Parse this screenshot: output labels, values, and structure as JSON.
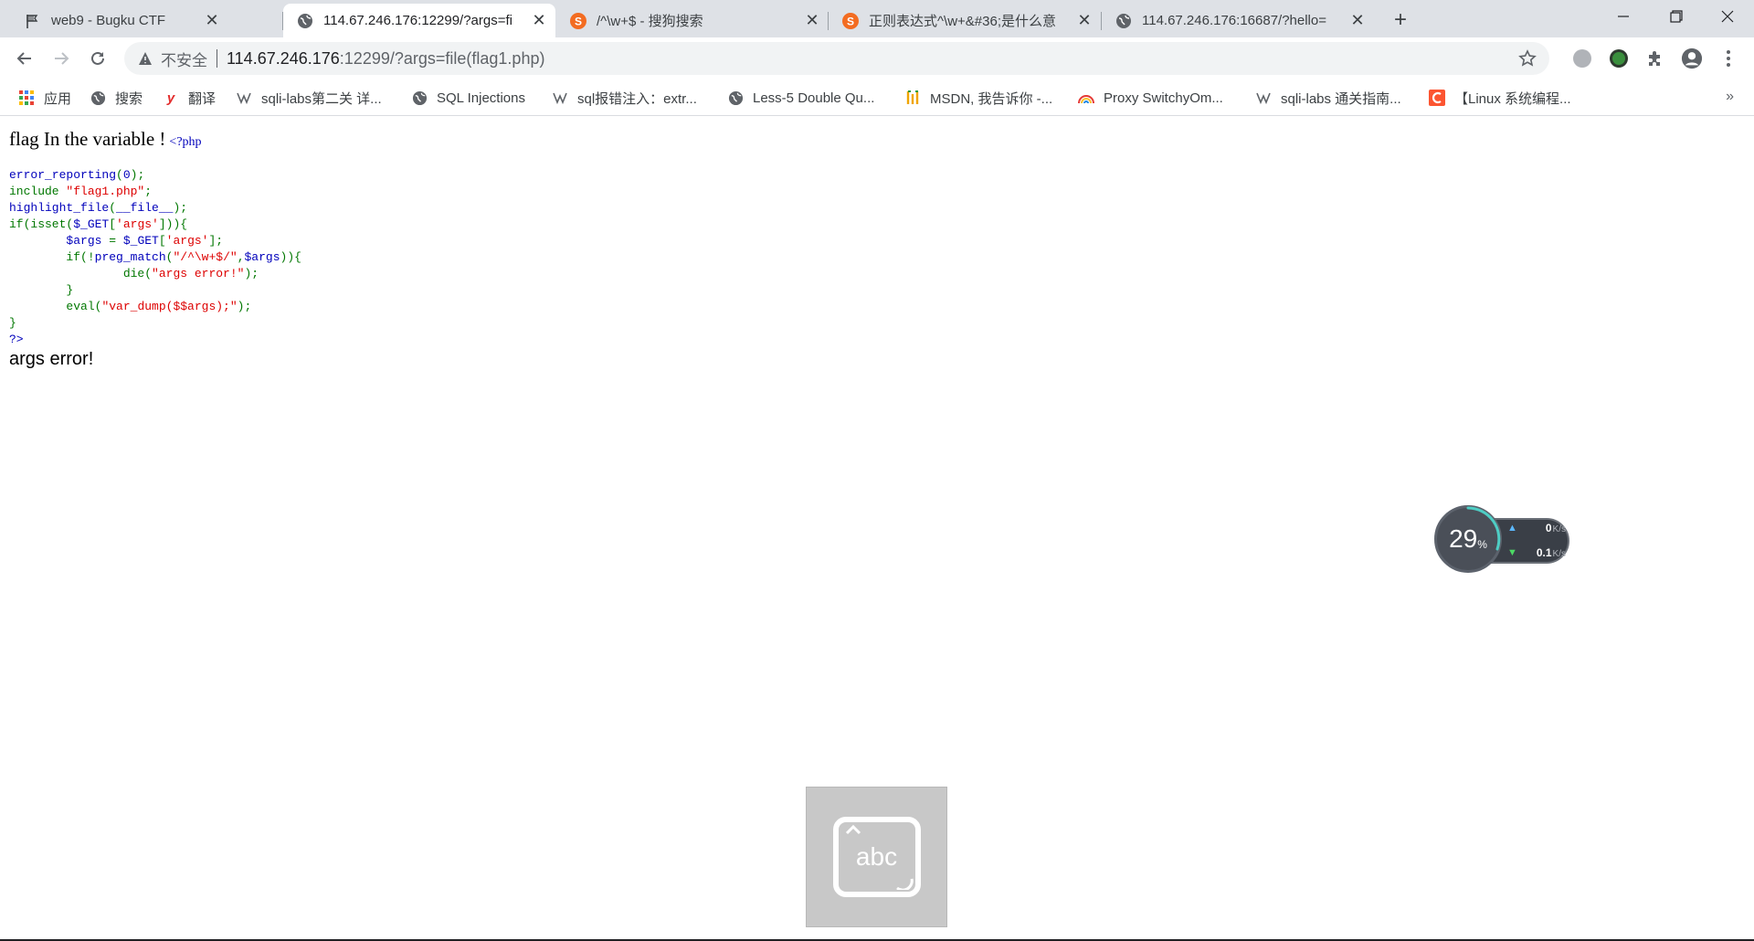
{
  "tabs": [
    {
      "title": "web9 - Bugku CTF",
      "icon": "flag-icon",
      "active": false
    },
    {
      "title": "114.67.246.176:12299/?args=fi",
      "icon": "globe-icon",
      "active": true
    },
    {
      "title": "/^\\w+$ - 搜狗搜索",
      "icon": "sogou-icon",
      "active": false
    },
    {
      "title": "正则表达式^\\w+&#36;是什么意",
      "icon": "sogou-icon",
      "active": false
    },
    {
      "title": "114.67.246.176:16687/?hello=",
      "icon": "globe-icon",
      "active": false
    }
  ],
  "toolbar": {
    "insecure_label": "不安全",
    "url_host": "114.67.246.176",
    "url_rest": ":12299/?args=file(flag1.php)"
  },
  "bookmarks": [
    {
      "label": "应用",
      "icon": "apps-grid-icon"
    },
    {
      "label": "搜索",
      "icon": "globe-icon"
    },
    {
      "label": "翻译",
      "icon": "youdao-icon"
    },
    {
      "label": "sqli-labs第二关 详...",
      "icon": "bookmark-icon"
    },
    {
      "label": "SQL Injections",
      "icon": "globe-icon"
    },
    {
      "label": "sql报错注入：extr...",
      "icon": "bookmark-icon"
    },
    {
      "label": "Less-5 Double Qu...",
      "icon": "globe-icon"
    },
    {
      "label": "MSDN, 我告诉你 -...",
      "icon": "msdn-icon"
    },
    {
      "label": "Proxy SwitchyOm...",
      "icon": "switchy-icon"
    },
    {
      "label": "sqli-labs 通关指南...",
      "icon": "bookmark-icon"
    },
    {
      "label": "【Linux 系统编程...",
      "icon": "csdn-icon"
    }
  ],
  "page": {
    "heading": "flag In the variable !",
    "php_open": "<?php",
    "code_lines": [
      [
        {
          "t": "error_reporting",
          "c": "c-def"
        },
        {
          "t": "(",
          "c": "c-kw"
        },
        {
          "t": "0",
          "c": "c-def"
        },
        {
          "t": ");",
          "c": "c-kw"
        }
      ],
      [
        {
          "t": "include ",
          "c": "c-kw"
        },
        {
          "t": "\"flag1.php\"",
          "c": "c-str"
        },
        {
          "t": ";",
          "c": "c-kw"
        }
      ],
      [
        {
          "t": "highlight_file",
          "c": "c-def"
        },
        {
          "t": "(",
          "c": "c-kw"
        },
        {
          "t": "__file__",
          "c": "c-def"
        },
        {
          "t": ");",
          "c": "c-kw"
        }
      ],
      [
        {
          "t": "if(isset(",
          "c": "c-kw"
        },
        {
          "t": "$_GET",
          "c": "c-def"
        },
        {
          "t": "[",
          "c": "c-kw"
        },
        {
          "t": "'args'",
          "c": "c-str"
        },
        {
          "t": "])){",
          "c": "c-kw"
        }
      ],
      [
        {
          "t": "        ",
          "c": "c-def"
        },
        {
          "t": "$args ",
          "c": "c-def"
        },
        {
          "t": "= ",
          "c": "c-kw"
        },
        {
          "t": "$_GET",
          "c": "c-def"
        },
        {
          "t": "[",
          "c": "c-kw"
        },
        {
          "t": "'args'",
          "c": "c-str"
        },
        {
          "t": "];",
          "c": "c-kw"
        }
      ],
      [
        {
          "t": "        ",
          "c": "c-def"
        },
        {
          "t": "if(!",
          "c": "c-kw"
        },
        {
          "t": "preg_match",
          "c": "c-def"
        },
        {
          "t": "(",
          "c": "c-kw"
        },
        {
          "t": "\"/^\\w+$/\"",
          "c": "c-str"
        },
        {
          "t": ",",
          "c": "c-kw"
        },
        {
          "t": "$args",
          "c": "c-def"
        },
        {
          "t": ")){",
          "c": "c-kw"
        }
      ],
      [
        {
          "t": "                ",
          "c": "c-def"
        },
        {
          "t": "die(",
          "c": "c-kw"
        },
        {
          "t": "\"args error!\"",
          "c": "c-str"
        },
        {
          "t": ");",
          "c": "c-kw"
        }
      ],
      [
        {
          "t": "        ",
          "c": "c-def"
        },
        {
          "t": "}",
          "c": "c-kw"
        }
      ],
      [
        {
          "t": "        ",
          "c": "c-def"
        },
        {
          "t": "eval(",
          "c": "c-kw"
        },
        {
          "t": "\"var_dump($$args);\"",
          "c": "c-str"
        },
        {
          "t": ");",
          "c": "c-kw"
        }
      ],
      [
        {
          "t": "}",
          "c": "c-kw"
        }
      ],
      [
        {
          "t": "?>",
          "c": "c-def"
        }
      ]
    ],
    "result": "args error!"
  },
  "speed_widget": {
    "percent": "29",
    "percent_sign": "%",
    "upload_value": "0",
    "download_value": "0.1",
    "unit": "K/s"
  },
  "ime_widget": {
    "label": "abc"
  },
  "colors": {
    "php_default": "#0000bb",
    "php_keyword": "#007700",
    "php_string": "#dd0000"
  }
}
